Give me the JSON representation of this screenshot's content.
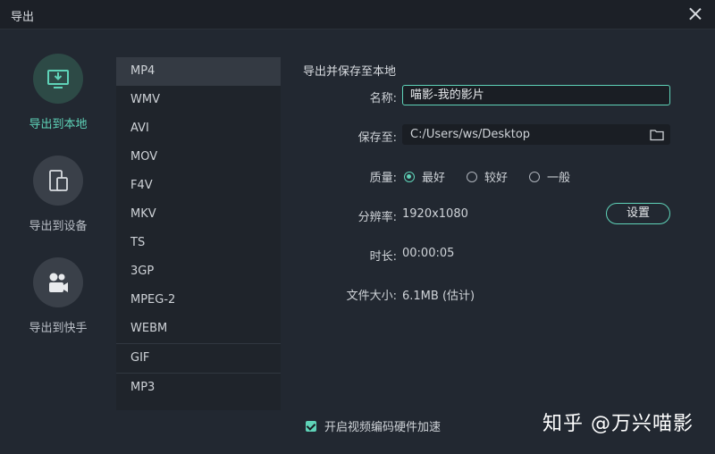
{
  "window": {
    "title": "导出"
  },
  "nav": [
    {
      "label": "导出到本地",
      "icon": "export-local-icon",
      "active": true
    },
    {
      "label": "导出到设备",
      "icon": "device-icon",
      "active": false
    },
    {
      "label": "导出到快手",
      "icon": "kuaishou-camera-icon",
      "active": false
    }
  ],
  "formats": [
    "MP4",
    "WMV",
    "AVI",
    "MOV",
    "F4V",
    "MKV",
    "TS",
    "3GP",
    "MPEG-2",
    "WEBM",
    "GIF",
    "MP3"
  ],
  "selected_format": "MP4",
  "panel": {
    "title": "导出并保存至本地",
    "name_label": "名称:",
    "name_value": "喵影-我的影片",
    "save_label": "保存至:",
    "save_path": "C:/Users/ws/Desktop",
    "quality_label": "质量:",
    "quality_options": [
      "最好",
      "较好",
      "一般"
    ],
    "quality_selected": "最好",
    "resolution_label": "分辨率:",
    "resolution_value": "1920x1080",
    "settings_button": "设置",
    "duration_label": "时长:",
    "duration_value": "00:00:05",
    "filesize_label": "文件大小:",
    "filesize_value": "6.1MB (估计)"
  },
  "hw_accel": {
    "label": "开启视频编码硬件加速",
    "checked": true
  },
  "watermark": "知乎 @万兴喵影",
  "colors": {
    "accent": "#5fd3b8",
    "background": "#222831",
    "list_bg": "#1f242b"
  }
}
